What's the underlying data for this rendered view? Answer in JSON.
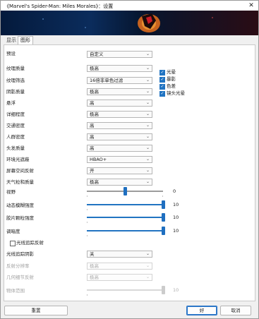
{
  "window": {
    "title": "《Marvel's Spider-Man: Miles Morales》：设置",
    "close_glyph": "✕"
  },
  "tabs": [
    {
      "label": "显示"
    },
    {
      "label": "图形"
    }
  ],
  "graphics": {
    "preset": {
      "label": "预设",
      "value": "自定义"
    },
    "texture_quality": {
      "label": "纹理质量",
      "value": "极高"
    },
    "texture_filtering": {
      "label": "纹理筛选",
      "value": "16倍非单色过滤"
    },
    "shadow_quality": {
      "label": "阴影质量",
      "value": "极高"
    },
    "reflections": {
      "label": "悬浮",
      "value": "高"
    },
    "detail_level": {
      "label": "详细程度",
      "value": "极高"
    },
    "traffic_density": {
      "label": "交通密度",
      "value": "高"
    },
    "crowd_density": {
      "label": "人群密度",
      "value": "高"
    },
    "hair_quality": {
      "label": "头发质量",
      "value": "高"
    },
    "ambient_occlusion": {
      "label": "环境光遮蔽",
      "value": "HBAO+"
    },
    "ssr": {
      "label": "屏幕空间反射",
      "value": "开"
    },
    "weather_quality": {
      "label": "天气粒和质量",
      "value": "极高"
    },
    "rt_shadows": {
      "label": "光线追踪阴影",
      "value": "关"
    },
    "rt_resolution": {
      "label": "反射分辨率",
      "value": "极高"
    },
    "rt_geometry": {
      "label": "几何细节反射",
      "value": "极高"
    }
  },
  "effects": [
    {
      "label": "光晕",
      "checked": true
    },
    {
      "label": "暴影",
      "checked": true
    },
    {
      "label": "色差",
      "checked": true
    },
    {
      "label": "镜头光晕",
      "checked": true
    }
  ],
  "sliders": {
    "fov": {
      "label": "视野",
      "value": 0,
      "fraction": 0.5
    },
    "motion_blur": {
      "label": "动态模糊强度",
      "value": 10,
      "fraction": 1.0
    },
    "film_grain": {
      "label": "胶片颗粒强度",
      "value": 10,
      "fraction": 1.0
    },
    "vignette": {
      "label": "调暗度",
      "value": 10,
      "fraction": 1.0
    },
    "object_range": {
      "label": "物体范围",
      "value": 10,
      "fraction": 1.0
    }
  },
  "raytracing_toggle": {
    "label": "光线追踪反射",
    "checked": false
  },
  "footer": {
    "reset_label": "重置",
    "ok_label": "好",
    "cancel_label": "取消"
  },
  "colors": {
    "accent": "#2174c2",
    "disabled_text": "#a3a3a3"
  }
}
